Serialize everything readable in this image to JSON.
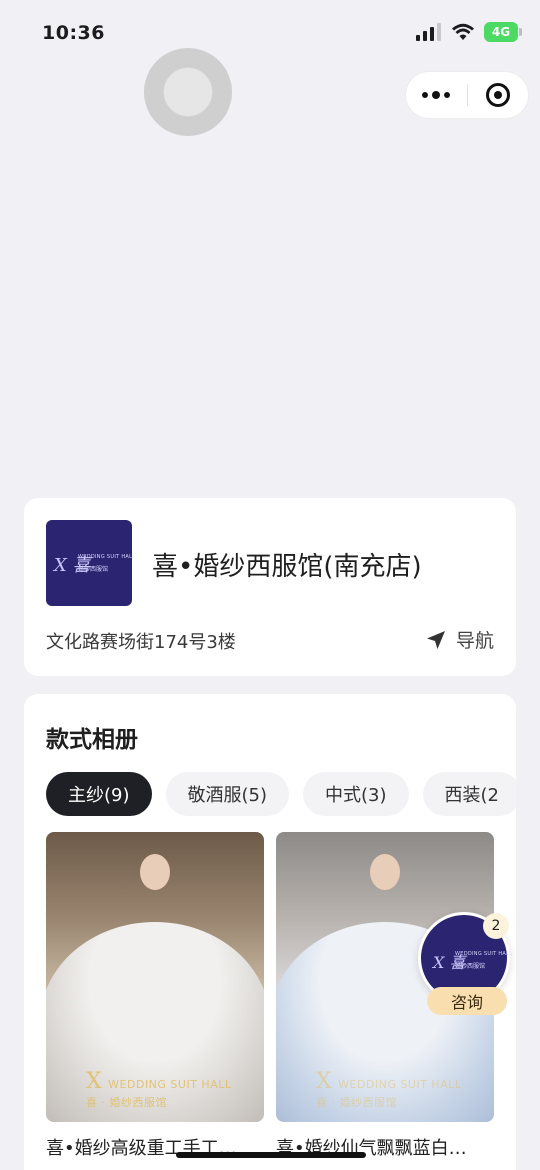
{
  "status_bar": {
    "time": "10:36",
    "network": "4G"
  },
  "capsule": {
    "more_icon": "more-dots-icon",
    "close_icon": "target-close-icon"
  },
  "store": {
    "logo_text_top": "WEDDING SUIT HALL",
    "logo_text_bottom": "婚纱西服馆",
    "logo_mark": "X 喜",
    "name": "喜•婚纱西服馆(南充店)",
    "address": "文化路赛场街174号3楼",
    "nav_label": "导航",
    "nav_icon": "navigation-arrow-icon"
  },
  "album": {
    "title": "款式相册",
    "tabs": [
      {
        "label": "主纱(9)",
        "active": true
      },
      {
        "label": "敬酒服(5)",
        "active": false
      },
      {
        "label": "中式(3)",
        "active": false
      },
      {
        "label": "西装(2",
        "active": false
      }
    ],
    "photos": [
      {
        "caption": "喜•婚纱高级重工手工…",
        "watermark_top": "WEDDING SUIT HALL",
        "watermark_bottom": "喜 · 婚纱西服馆"
      },
      {
        "caption": "喜•婚纱仙气飘飘蓝白…",
        "watermark_top": "WEDDING SUIT HALL",
        "watermark_bottom": "喜 · 婚纱西服馆"
      }
    ]
  },
  "consult": {
    "label": "咨询",
    "badge": "2"
  },
  "colors": {
    "brand_navy": "#2b2470",
    "tab_active": "#1f2025",
    "consult_gold": "#f9dfb0",
    "battery_green": "#4cd964"
  }
}
